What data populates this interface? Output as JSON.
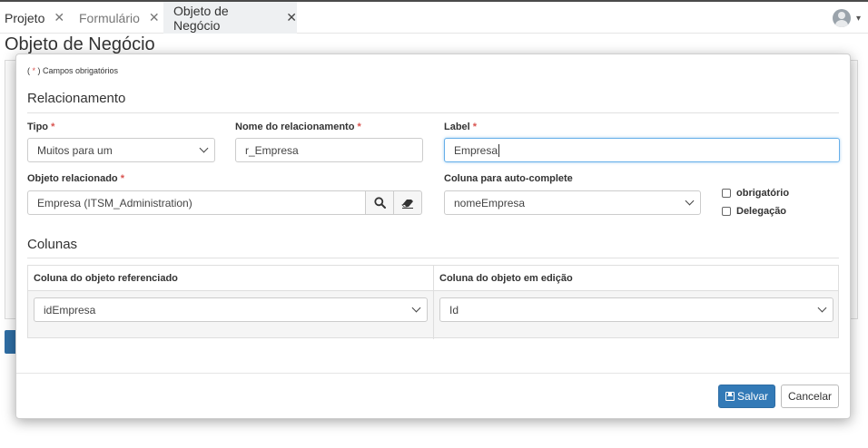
{
  "tabs": [
    {
      "label": "Projeto",
      "active": false,
      "close": "✕"
    },
    {
      "label": "Formulário",
      "active": false,
      "close": "✕"
    },
    {
      "label": "Objeto de Negócio",
      "active": true,
      "close": "✕"
    }
  ],
  "page": {
    "title": "Objeto de Negócio"
  },
  "modal": {
    "required_note_open": "( ",
    "required_star": "*",
    "required_note_close": " ) Campos obrigatórios",
    "section_relacionamento": "Relacionamento",
    "section_colunas": "Colunas",
    "fields": {
      "tipo": {
        "label": "Tipo",
        "star": "*",
        "value": "Muitos para um"
      },
      "nome": {
        "label": "Nome do relacionamento",
        "star": "*",
        "value": "r_Empresa"
      },
      "label": {
        "label": "Label",
        "star": "*",
        "value": "Empresa"
      },
      "objeto": {
        "label": "Objeto relacionado",
        "star": "*",
        "value": "Empresa (ITSM_Administration)"
      },
      "coluna_auto": {
        "label": "Coluna para auto-complete",
        "value": "nomeEmpresa"
      }
    },
    "checkboxes": {
      "obrigatorio": {
        "label": "obrigatório",
        "checked": false
      },
      "delegacao": {
        "label": "Delegação",
        "checked": false
      }
    },
    "table": {
      "headers": [
        "Coluna do objeto referenciado",
        "Coluna do objeto em edição"
      ],
      "row": [
        "idEmpresa",
        "Id"
      ]
    },
    "buttons": {
      "save": "Salvar",
      "cancel": "Cancelar"
    }
  },
  "colors": {
    "primary": "#337ab7",
    "required": "#d9534f",
    "focus": "#66afe9"
  },
  "icons": [
    "user-avatar-icon",
    "search-icon",
    "eraser-icon",
    "save-icon",
    "chevron-down-icon",
    "close-icon"
  ]
}
